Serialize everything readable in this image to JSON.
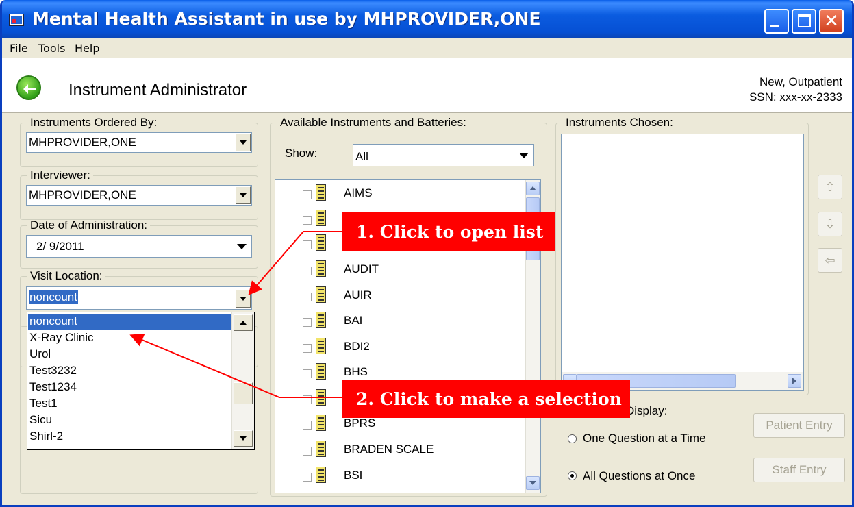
{
  "window": {
    "title": "Mental Health Assistant in use by MHPROVIDER,ONE"
  },
  "menu": [
    "File",
    "Tools",
    "Help"
  ],
  "header": {
    "title": "Instrument Administrator",
    "patient_name": "New, Outpatient",
    "ssn": "SSN: xxx-xx-2333"
  },
  "ordered_by": {
    "label": "Instruments Ordered By:",
    "value": "MHPROVIDER,ONE"
  },
  "interviewer": {
    "label": "Interviewer:",
    "value": "MHPROVIDER,ONE"
  },
  "date": {
    "label": "Date of Administration:",
    "value": "2/ 9/2011"
  },
  "visit_location": {
    "label": "Visit Location:",
    "value": "noncount",
    "options": [
      "noncount",
      "X-Ray Clinic",
      "Urol",
      "Test3232",
      "Test1234",
      "Test1",
      "Sicu",
      "Shirl-2"
    ]
  },
  "available": {
    "label": "Available Instruments and Batteries:",
    "show_label": "Show:",
    "show_value": "All",
    "items": [
      "AIMS",
      "",
      "",
      "AUDIT",
      "AUIR",
      "BAI",
      "BDI2",
      "BHS",
      "",
      "BPRS",
      "BRADEN SCALE",
      "BSI"
    ]
  },
  "chosen": {
    "label": "Instruments Chosen:"
  },
  "display": {
    "label": "Display:",
    "option_one": "One Question at a Time",
    "option_all": "All Questions at Once",
    "selected": "All Questions at Once"
  },
  "buttons": {
    "patient_entry": "Patient Entry",
    "staff_entry": "Staff Entry"
  },
  "callouts": {
    "open_list": "1. Click to open list",
    "make_selection": "2. Click to make a selection"
  },
  "colors": {
    "title_bar": "#0b5ce0",
    "selection": "#316ac5",
    "callout": "#ff0000"
  }
}
